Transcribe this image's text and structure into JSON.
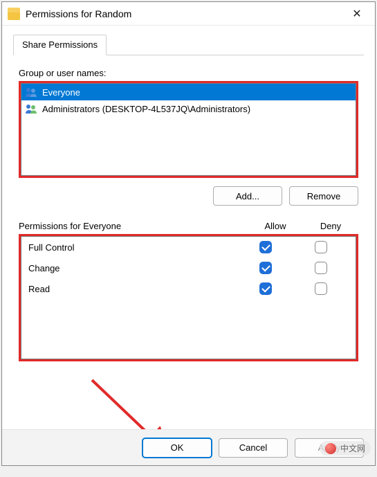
{
  "window": {
    "title": "Permissions for Random",
    "close_glyph": "✕"
  },
  "tabs": [
    {
      "label": "Share Permissions"
    }
  ],
  "labels": {
    "group_or_user_names": "Group or user names:",
    "permissions_for": "Permissions for Everyone",
    "allow": "Allow",
    "deny": "Deny"
  },
  "users": [
    {
      "name": "Everyone",
      "selected": true
    },
    {
      "name": "Administrators (DESKTOP-4L537JQ\\Administrators)",
      "selected": false
    }
  ],
  "buttons": {
    "add": "Add...",
    "remove": "Remove",
    "ok": "OK",
    "cancel": "Cancel",
    "apply": "Apply"
  },
  "permissions": [
    {
      "name": "Full Control",
      "allow": true,
      "deny": false
    },
    {
      "name": "Change",
      "allow": true,
      "deny": false
    },
    {
      "name": "Read",
      "allow": true,
      "deny": false
    }
  ],
  "watermark": "中文网",
  "annotation_color": "#e12a2a"
}
